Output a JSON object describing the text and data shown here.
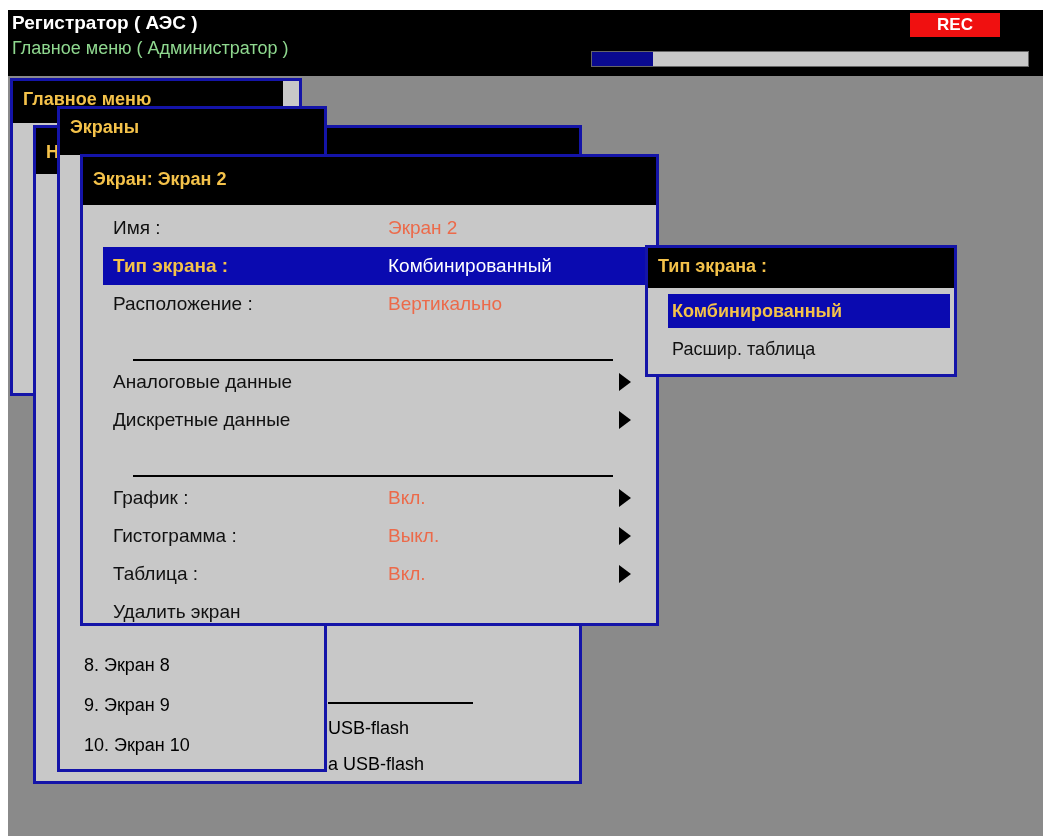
{
  "header": {
    "title": "Регистратор ( АЭС )",
    "subtitle": "Главное меню ( Администратор )",
    "rec_badge": "REC",
    "progress": {
      "level": 0.14
    }
  },
  "main_menu_window": {
    "title": "Главное меню"
  },
  "background_window": {
    "title": "Н",
    "items": [
      {
        "kind": "divider"
      },
      {
        "kind": "item",
        "label": "USB-flash"
      },
      {
        "kind": "item",
        "label": "а USB-flash"
      }
    ]
  },
  "screens_window": {
    "title": "Экраны",
    "items": [
      {
        "label": "8. Экран 8"
      },
      {
        "label": "9. Экран 9"
      },
      {
        "label": "10. Экран 10"
      }
    ]
  },
  "screen_window": {
    "title": "Экран: Экран 2",
    "rows": [
      {
        "kind": "setting",
        "label": "Имя :",
        "value": "Экран 2",
        "selected": false,
        "submenu": false
      },
      {
        "kind": "setting",
        "label": "Тип экрана :",
        "value": "Комбинированный",
        "selected": true,
        "submenu": false
      },
      {
        "kind": "setting",
        "label": "Расположение :",
        "value": "Вертикально",
        "selected": false,
        "submenu": false
      },
      {
        "kind": "divider"
      },
      {
        "kind": "setting",
        "label": "Аналоговые данные",
        "selected": false,
        "submenu": true
      },
      {
        "kind": "setting",
        "label": "Дискретные данные",
        "selected": false,
        "submenu": true
      },
      {
        "kind": "divider"
      },
      {
        "kind": "setting",
        "label": "График :",
        "value": "Вкл.",
        "selected": false,
        "submenu": true
      },
      {
        "kind": "setting",
        "label": "Гистограмма :",
        "value": "Выкл.",
        "selected": false,
        "submenu": true
      },
      {
        "kind": "setting",
        "label": "Таблица :",
        "value": "Вкл.",
        "selected": false,
        "submenu": true
      },
      {
        "kind": "setting",
        "label": "Удалить экран",
        "selected": false,
        "submenu": false
      }
    ]
  },
  "popup": {
    "title": "Тип экрана :",
    "options": [
      {
        "label": "Комбинированный",
        "selected": true
      },
      {
        "label": "Расшир. таблица",
        "selected": false
      }
    ]
  }
}
